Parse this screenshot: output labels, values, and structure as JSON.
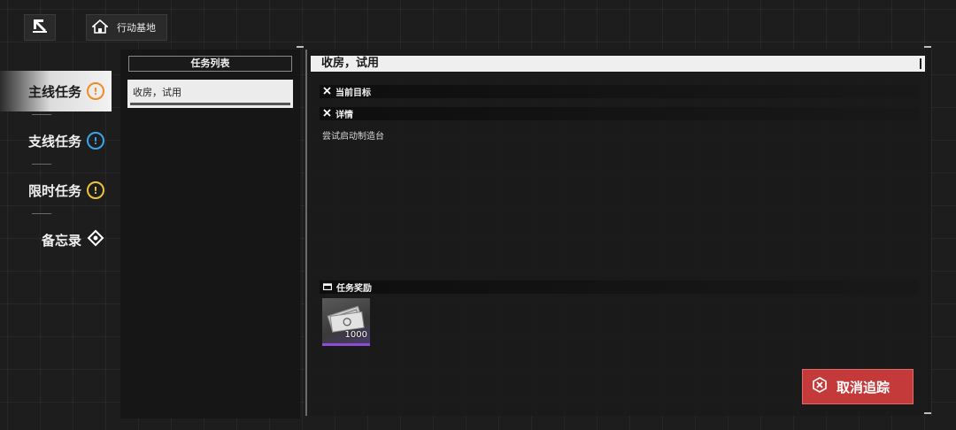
{
  "top_bar": {
    "base_label": "行动基地"
  },
  "sidebar": {
    "items": [
      {
        "label": "主线任务",
        "badge": "!",
        "color": "#f08a24",
        "active": true
      },
      {
        "label": "支线任务",
        "badge": "!",
        "color": "#3ba4ea",
        "active": false
      },
      {
        "label": "限时任务",
        "badge": "!",
        "color": "#e9c53b",
        "active": false
      },
      {
        "label": "备忘录",
        "icon": "target-icon",
        "active": false
      }
    ]
  },
  "task_list": {
    "header": "任务列表",
    "items": [
      {
        "label": "收房，试用",
        "selected": true
      }
    ]
  },
  "detail": {
    "title": "收房，试用",
    "current_goal_label": "当前目标",
    "details_label": "详情",
    "description": "尝试启动制造台",
    "reward_label": "任务奖励",
    "rewards": [
      {
        "icon": "banknote-icon",
        "quantity": "1000",
        "rarity_color": "#8a4fd0"
      }
    ]
  },
  "cancel_button": {
    "label": "取消追踪",
    "icon": "close-circle-icon",
    "color": "#c43a3a"
  }
}
